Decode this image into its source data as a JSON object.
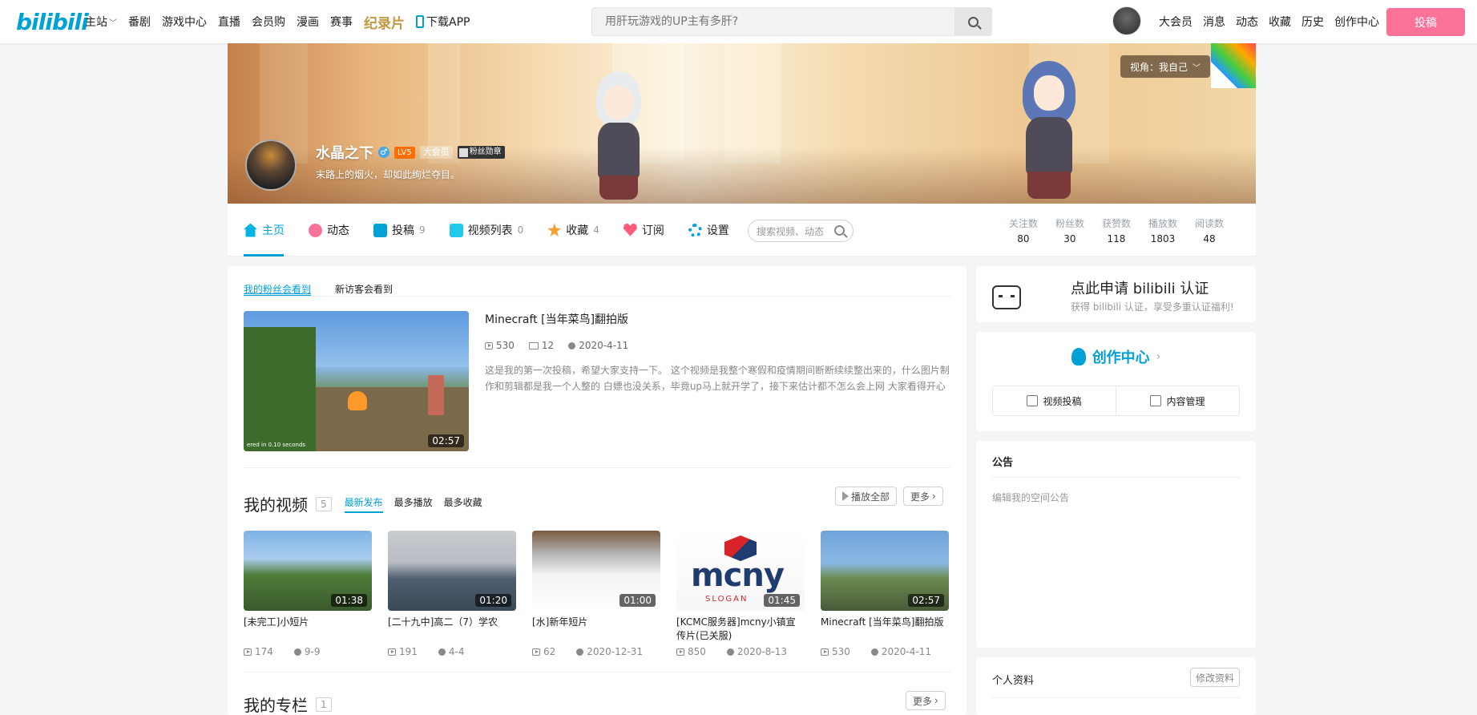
{
  "topnav": {
    "logo": "bilibili",
    "main_station": "主站",
    "links": [
      "番剧",
      "游戏中心",
      "直播",
      "会员购",
      "漫画",
      "赛事"
    ],
    "documentary": "纪录片",
    "download_app": "下载APP",
    "search_placeholder": "用肝玩游戏的UP主有多肝?",
    "right_links": [
      "大会员",
      "消息",
      "动态",
      "收藏",
      "历史",
      "创作中心"
    ],
    "upload_button": "投稿"
  },
  "banner": {
    "view_label": "视角：我自己",
    "username": "水晶之下",
    "gender_symbol": "♂",
    "level": "LV5",
    "vip": "大会员",
    "fan_medal": "粉丝勋章",
    "signature": "末路上的烟火，却如此绚烂夺目。"
  },
  "tabs": [
    {
      "label": "主页",
      "count": "",
      "icon": "home-icon",
      "color": "#00b5e5"
    },
    {
      "label": "动态",
      "count": "",
      "icon": "dynamic-icon",
      "color": "#fb7299"
    },
    {
      "label": "投稿",
      "count": "9",
      "icon": "upload-icon",
      "color": "#00a1d6"
    },
    {
      "label": "视频列表",
      "count": "0",
      "icon": "playlist-icon",
      "color": "#23c9ed"
    },
    {
      "label": "收藏",
      "count": "4",
      "icon": "star-icon",
      "color": "#f3a034"
    },
    {
      "label": "订阅",
      "count": "",
      "icon": "heart-icon",
      "color": "#ff5c7c"
    },
    {
      "label": "设置",
      "count": "",
      "icon": "gear-icon",
      "color": "#00a1d6"
    }
  ],
  "tab_search_placeholder": "搜索视频、动态",
  "stats": [
    {
      "label": "关注数",
      "value": "80"
    },
    {
      "label": "粉丝数",
      "value": "30"
    },
    {
      "label": "获赞数",
      "value": "118"
    },
    {
      "label": "播放数",
      "value": "1803"
    },
    {
      "label": "阅读数",
      "value": "48"
    }
  ],
  "featured": {
    "subtabs": [
      "我的粉丝会看到",
      "新访客会看到"
    ],
    "title": "Minecraft [当年菜鸟]翻拍版",
    "plays": "530",
    "danmaku": "12",
    "date": "2020-4-11",
    "duration": "02:57",
    "thumb_caption": "ered in 0.10 seconds",
    "description": "这是我的第一次投稿，希望大家支持一下。 这个视频是我整个寒假和疫情期间断断续续整出来的，什么图片制作和剪辑都是我一个人整的 白嫖也没关系，毕竟up马上就开学了，接下来估计都不怎么会上网 大家看得开心"
  },
  "my_videos": {
    "title": "我的视频",
    "count": "5",
    "sorts": [
      "最新发布",
      "最多播放",
      "最多收藏"
    ],
    "play_all": "播放全部",
    "more": "更多",
    "items": [
      {
        "title": "[未完工]小短片",
        "duration": "01:38",
        "plays": "174",
        "date": "9-9"
      },
      {
        "title": "[二十九中]高二（7）学农",
        "duration": "01:20",
        "plays": "191",
        "date": "4-4"
      },
      {
        "title": "[水]新年短片",
        "duration": "01:00",
        "plays": "62",
        "date": "2020-12-31"
      },
      {
        "title": "[KCMC服务器]mcny小镇宣传片(已关服)",
        "duration": "01:45",
        "plays": "850",
        "date": "2020-8-13",
        "logo_text": "mcny",
        "slogan": "SLOGAN"
      },
      {
        "title": "Minecraft [当年菜鸟]翻拍版",
        "duration": "02:57",
        "plays": "530",
        "date": "2020-4-11"
      }
    ]
  },
  "my_columns": {
    "title": "我的专栏",
    "count": "1",
    "more": "更多"
  },
  "right": {
    "cert_title": "点此申请 bilibili 认证",
    "cert_sub": "获得 bilibili 认证，享受多重认证福利!",
    "creator_title": "创作中心",
    "creator_upload": "视频投稿",
    "creator_manage": "内容管理",
    "notice_title": "公告",
    "notice_placeholder": "编辑我的空间公告",
    "profile_title": "个人资料",
    "profile_edit": "修改资料"
  }
}
